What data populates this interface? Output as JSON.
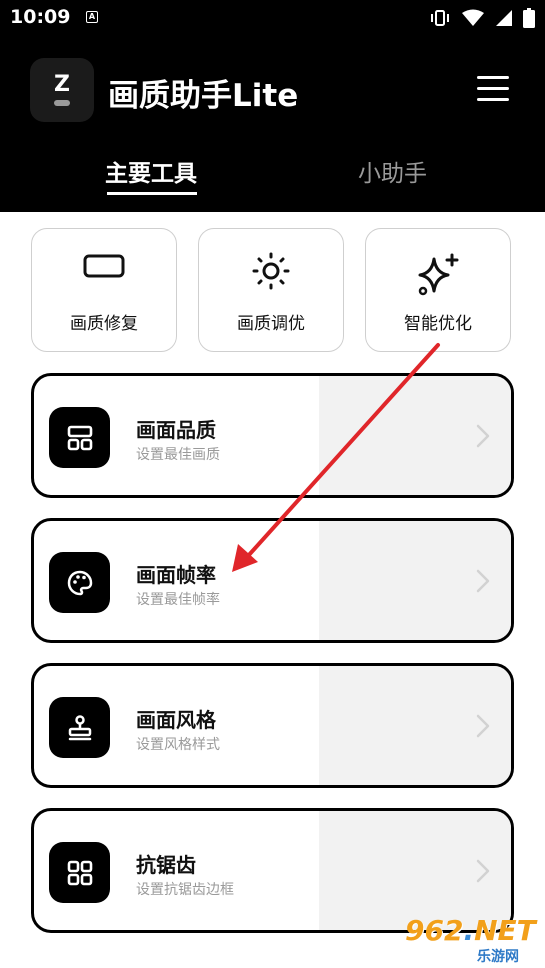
{
  "status_bar": {
    "time": "10:09",
    "notification_badge": "A"
  },
  "header": {
    "logo_letter": "Z",
    "app_title": "画质助手Lite",
    "menu_icon": "hamburger-menu-icon"
  },
  "tabs": [
    {
      "label": "主要工具",
      "active": true
    },
    {
      "label": "小助手",
      "active": false
    }
  ],
  "tools": [
    {
      "label": "画质修复",
      "icon": "rectangle-icon"
    },
    {
      "label": "画质调优",
      "icon": "sun-icon"
    },
    {
      "label": "智能优化",
      "icon": "sparkle-icon"
    }
  ],
  "features": [
    {
      "title": "画面品质",
      "subtitle": "设置最佳画质",
      "icon": "layout-grid-icon"
    },
    {
      "title": "画面帧率",
      "subtitle": "设置最佳帧率",
      "icon": "palette-icon"
    },
    {
      "title": "画面风格",
      "subtitle": "设置风格样式",
      "icon": "stamp-icon"
    },
    {
      "title": "抗锯齿",
      "subtitle": "设置抗锯齿边框",
      "icon": "four-squares-icon"
    }
  ],
  "watermark": {
    "number_a": "962",
    "number_b": "NET",
    "sub": "乐游网"
  },
  "colors": {
    "header_bg": "#000000",
    "card_border": "#000000",
    "card_right_bg": "#f2f2f2",
    "annotation_arrow": "#e0262a"
  }
}
